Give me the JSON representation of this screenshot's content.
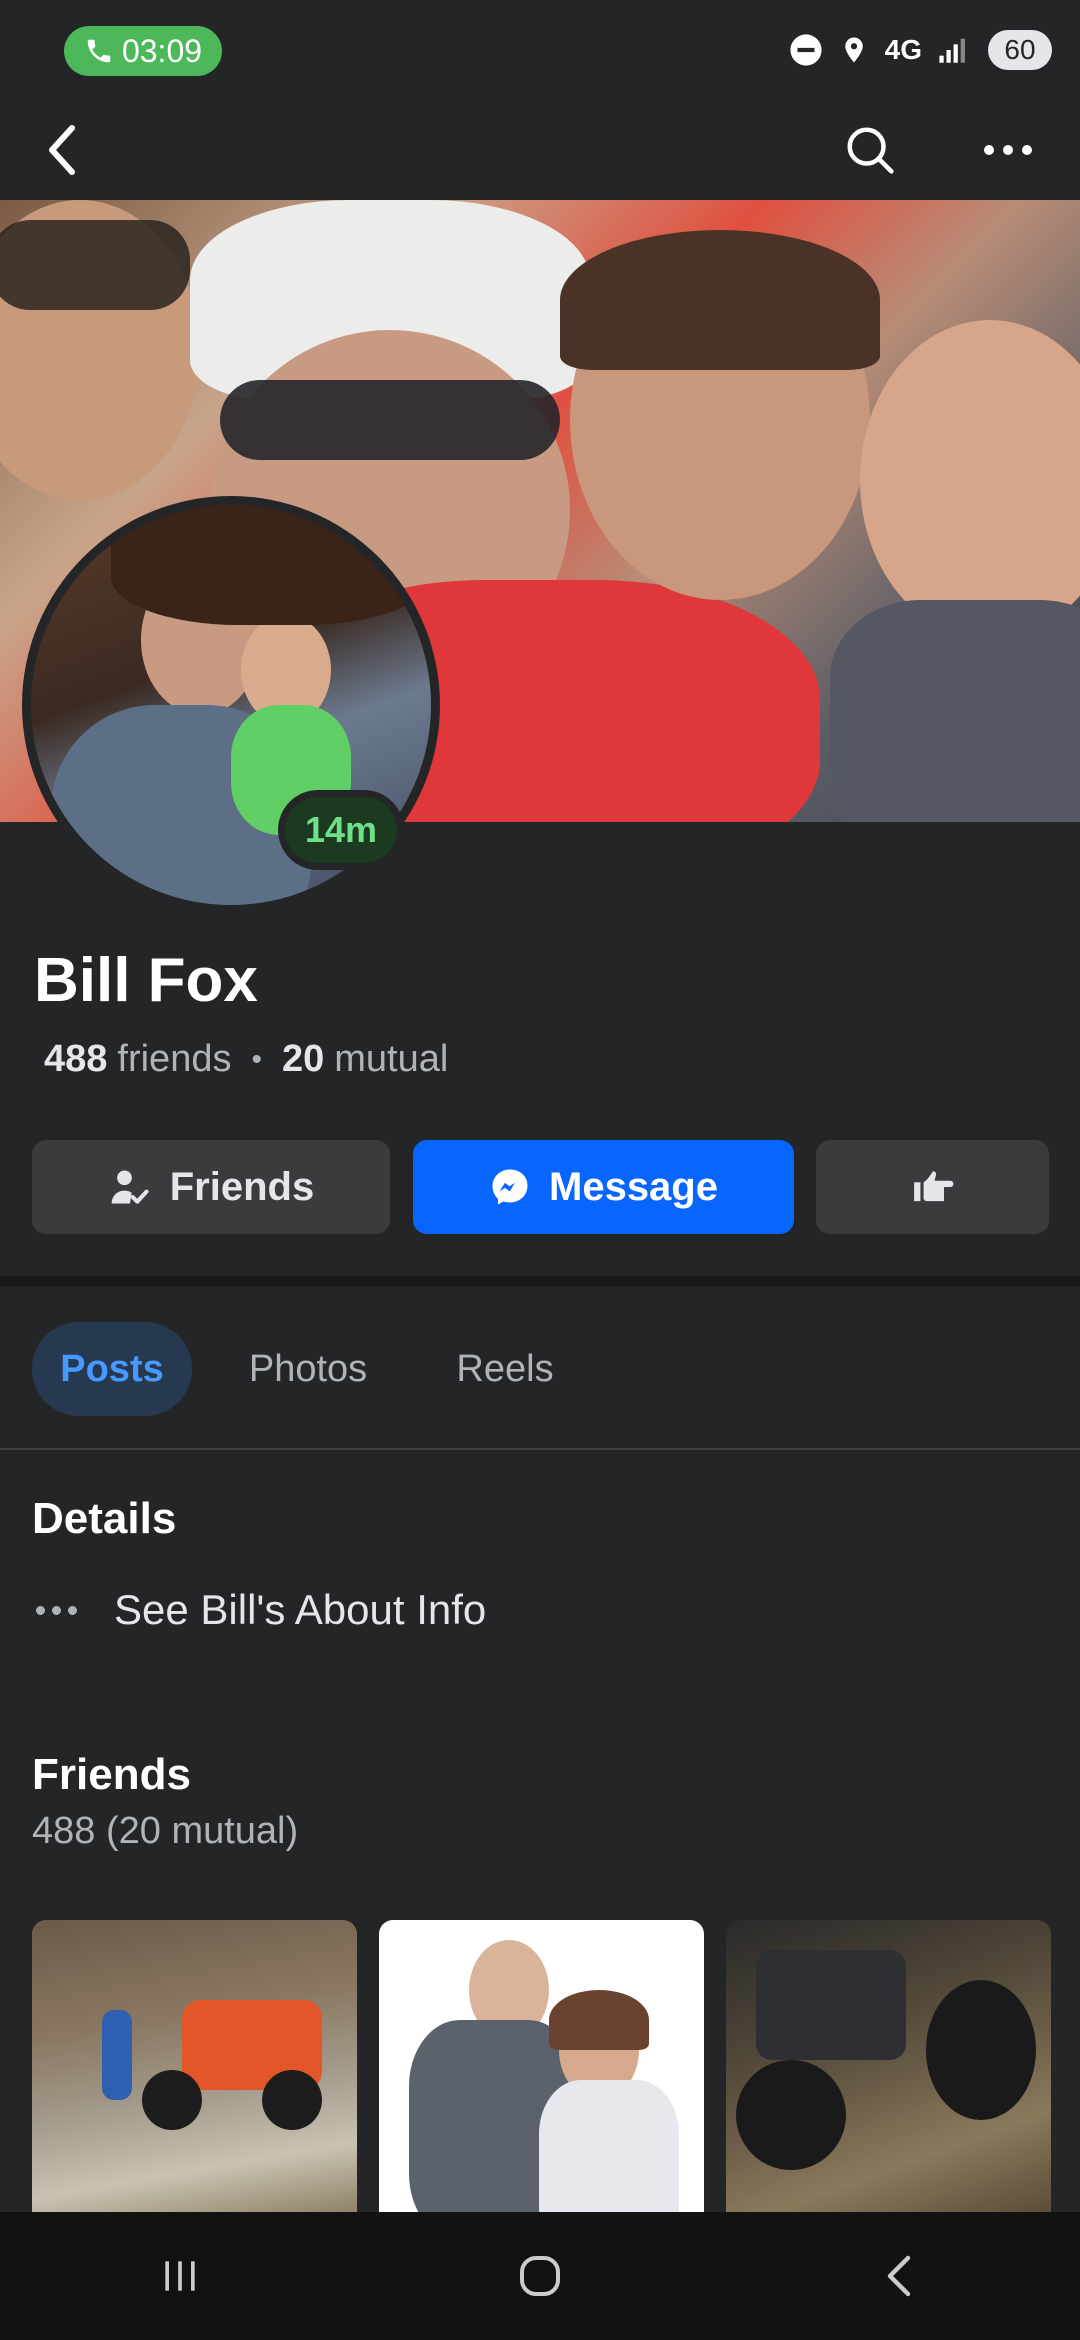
{
  "status_bar": {
    "time": "03:09",
    "network": "4G",
    "battery": "60"
  },
  "icons": {
    "back": "back-arrow-icon",
    "search": "search-icon",
    "more": "more-dots-icon",
    "friends": "friends-check-icon",
    "messenger": "messenger-icon",
    "poke": "poke-hand-icon"
  },
  "profile": {
    "online_badge": "14m",
    "name": "Bill Fox",
    "friends_count": "488",
    "friends_word": "friends",
    "separator": "•",
    "mutual_count": "20",
    "mutual_word": "mutual"
  },
  "actions": {
    "friends_label": "Friends",
    "message_label": "Message"
  },
  "tabs": [
    {
      "label": "Posts",
      "active": true
    },
    {
      "label": "Photos",
      "active": false
    },
    {
      "label": "Reels",
      "active": false
    }
  ],
  "details": {
    "title": "Details",
    "about_link": "See Bill's About Info"
  },
  "friends_section": {
    "title": "Friends",
    "subtitle": "488 (20 mutual)"
  },
  "colors": {
    "background": "#242526",
    "accent": "#0866ff",
    "active_tab_bg": "#263951",
    "active_tab_text": "#4599ff",
    "online_green": "#6fe08a"
  }
}
